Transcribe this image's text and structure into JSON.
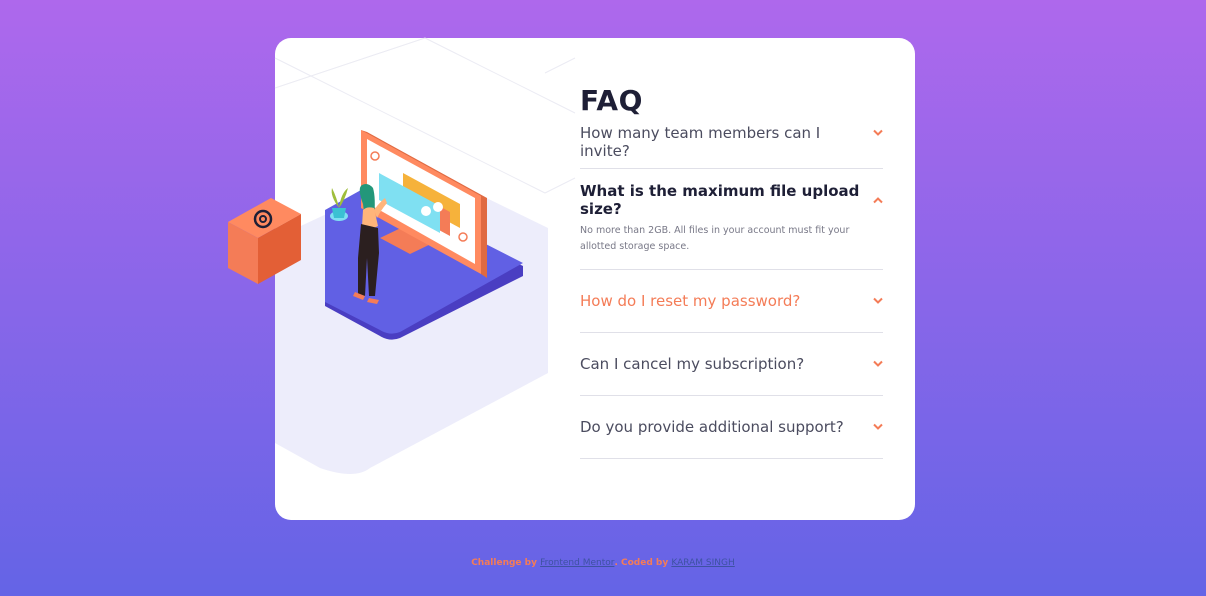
{
  "faq": {
    "title": "FAQ",
    "items": [
      {
        "question": "How many team members can I invite?",
        "state": "collapsed"
      },
      {
        "question": "What is the maximum file upload size?",
        "state": "expanded",
        "answer": "No more than 2GB. All files in your account must fit your allotted storage space."
      },
      {
        "question": "How do I reset my password?",
        "state": "hover"
      },
      {
        "question": "Can I cancel my subscription?",
        "state": "collapsed"
      },
      {
        "question": "Do you provide additional support?",
        "state": "collapsed"
      }
    ]
  },
  "footer": {
    "prefix": "Challenge by",
    "frontend_mentor": "Frontend Mentor",
    "middle": ". Coded by",
    "author": "KARAM SINGH"
  },
  "colors": {
    "accent": "#f47c57",
    "text_dark": "#1e1f36",
    "bg_top": "#ae68ec",
    "bg_bottom": "#6464e6"
  },
  "icons": {
    "chevron": "chevron-down-icon",
    "box": "at-sign-box-icon"
  }
}
